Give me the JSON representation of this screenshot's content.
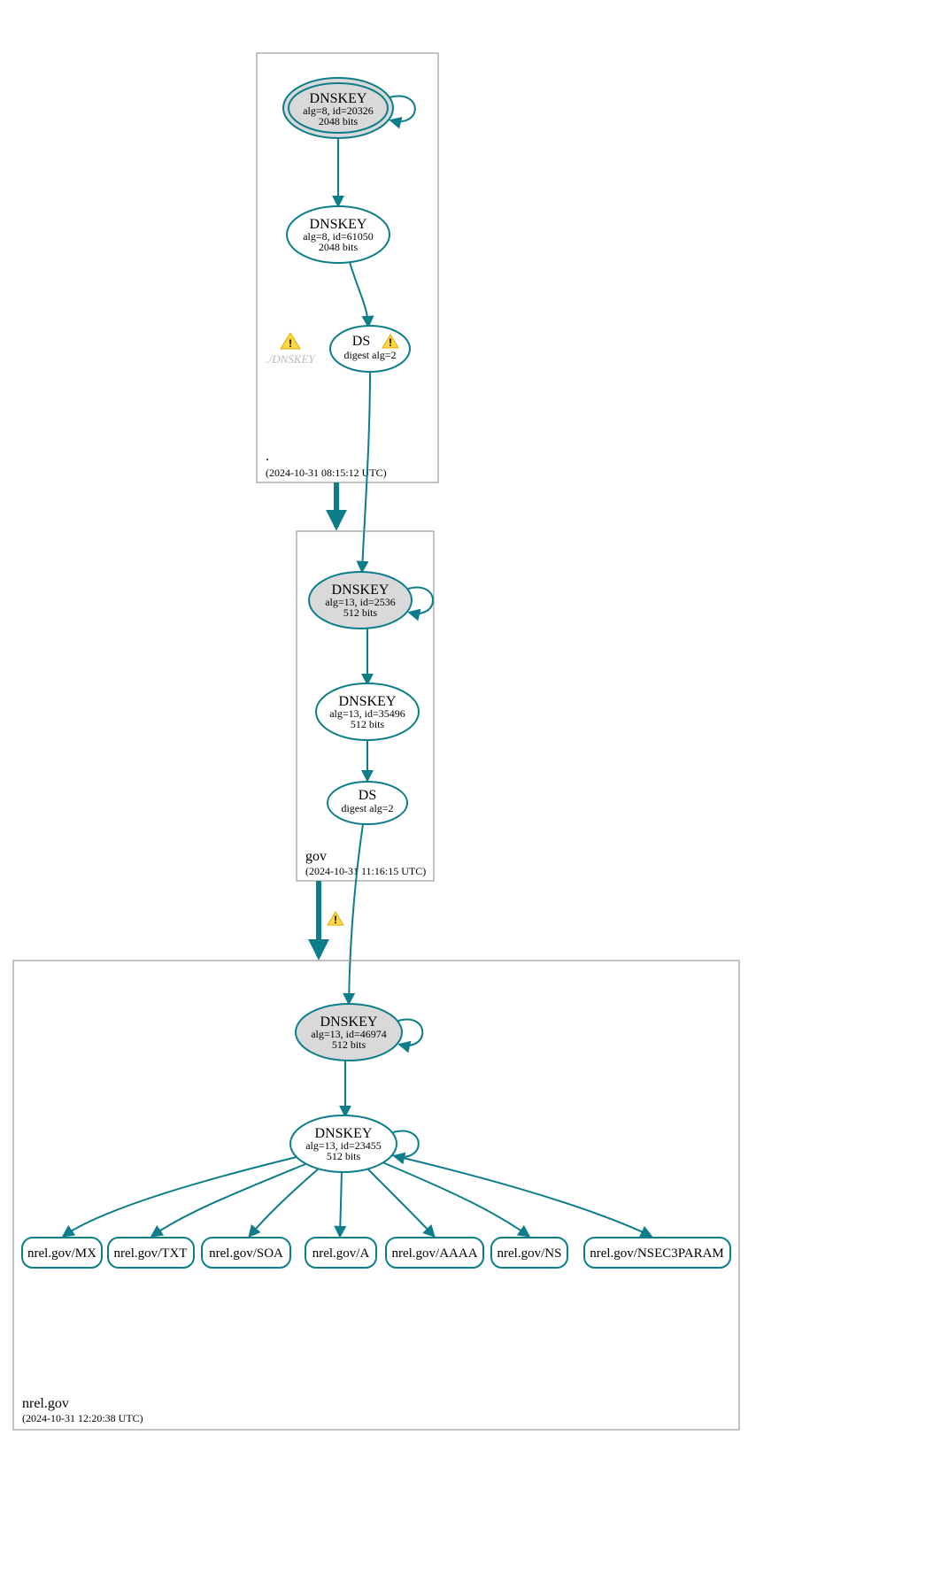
{
  "colors": {
    "stroke": "#0d7d8a",
    "ksk_fill": "#d9d9d9",
    "warn": "#ffd84a"
  },
  "zones": {
    "root": {
      "name": ".",
      "timestamp": "(2024-10-31 08:15:12 UTC)"
    },
    "gov": {
      "name": "gov",
      "timestamp": "(2024-10-31 11:16:15 UTC)"
    },
    "nrel": {
      "name": "nrel.gov",
      "timestamp": "(2024-10-31 12:20:38 UTC)"
    }
  },
  "nodes": {
    "root_ksk": {
      "title": "DNSKEY",
      "line2": "alg=8, id=20326",
      "line3": "2048 bits"
    },
    "root_zsk": {
      "title": "DNSKEY",
      "line2": "alg=8, id=61050",
      "line3": "2048 bits"
    },
    "root_ds": {
      "title": "DS",
      "line2": "digest alg=2"
    },
    "root_ghost": {
      "label": "./DNSKEY"
    },
    "gov_ksk": {
      "title": "DNSKEY",
      "line2": "alg=13, id=2536",
      "line3": "512 bits"
    },
    "gov_zsk": {
      "title": "DNSKEY",
      "line2": "alg=13, id=35496",
      "line3": "512 bits"
    },
    "gov_ds": {
      "title": "DS",
      "line2": "digest alg=2"
    },
    "nrel_ksk": {
      "title": "DNSKEY",
      "line2": "alg=13, id=46974",
      "line3": "512 bits"
    },
    "nrel_zsk": {
      "title": "DNSKEY",
      "line2": "alg=13, id=23455",
      "line3": "512 bits"
    }
  },
  "records": {
    "mx": "nrel.gov/MX",
    "txt": "nrel.gov/TXT",
    "soa": "nrel.gov/SOA",
    "a": "nrel.gov/A",
    "aaaa": "nrel.gov/AAAA",
    "ns": "nrel.gov/NS",
    "nsec": "nrel.gov/NSEC3PARAM"
  }
}
